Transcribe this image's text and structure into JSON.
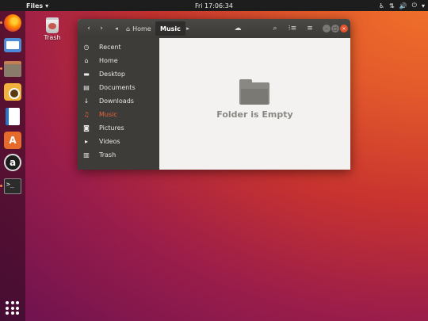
{
  "topbar": {
    "app_menu": "Files",
    "clock": "Fri 17:06:34"
  },
  "dock": {
    "items": [
      "firefox-icon",
      "thunderbird-icon",
      "files-icon",
      "rhythmbox-icon",
      "libreoffice-writer-icon",
      "ubuntu-software-icon",
      "amazon-icon",
      "terminal-icon"
    ],
    "show_apps": "show-applications-icon"
  },
  "desktop": {
    "trash_label": "Trash"
  },
  "window": {
    "path": {
      "home": "Home",
      "current": "Music"
    },
    "sidebar": {
      "items": [
        {
          "label": "Recent",
          "icon": "clock-icon"
        },
        {
          "label": "Home",
          "icon": "home-icon"
        },
        {
          "label": "Desktop",
          "icon": "folder-icon"
        },
        {
          "label": "Documents",
          "icon": "document-icon"
        },
        {
          "label": "Downloads",
          "icon": "download-icon"
        },
        {
          "label": "Music",
          "icon": "music-icon",
          "active": true
        },
        {
          "label": "Pictures",
          "icon": "camera-icon"
        },
        {
          "label": "Videos",
          "icon": "video-icon"
        },
        {
          "label": "Trash",
          "icon": "trash-icon"
        }
      ]
    },
    "content": {
      "empty_message": "Folder is Empty"
    }
  },
  "colors": {
    "accent": "#e8643a",
    "headerbar": "#3b3a37",
    "sidebar": "#3d3c38",
    "content_bg": "#f3f2f0",
    "topbar": "#1d1d1d"
  }
}
